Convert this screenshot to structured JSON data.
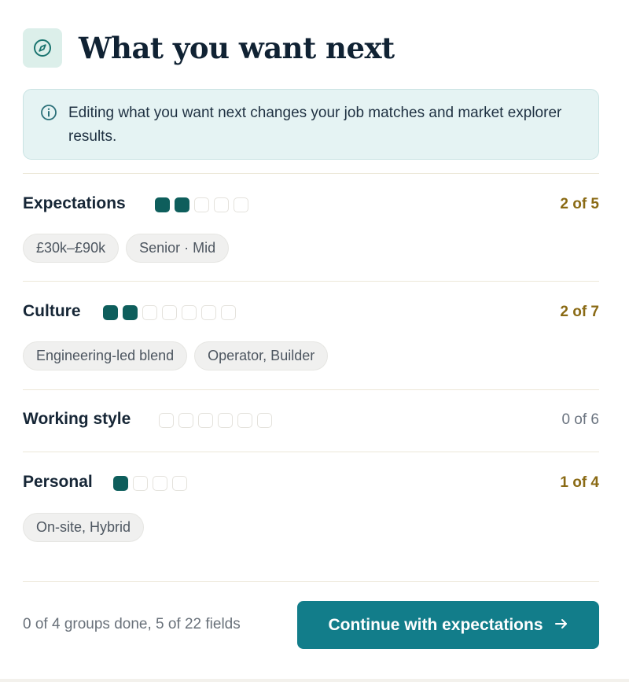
{
  "header": {
    "title": "What you want next",
    "icon": "compass-icon"
  },
  "notice": {
    "icon": "info-icon",
    "text": "Editing what you want next changes your job matches and market explorer results."
  },
  "groups": [
    {
      "title": "Expectations",
      "filled": 2,
      "total": 5,
      "count": "2 of 5",
      "chips": [
        "£30k–£90k",
        "Senior · Mid"
      ]
    },
    {
      "title": "Culture",
      "filled": 2,
      "total": 7,
      "count": "2 of 7",
      "chips": [
        "Engineering-led blend",
        "Operator, Builder"
      ]
    },
    {
      "title": "Working style",
      "filled": 0,
      "total": 6,
      "count": "0 of 6",
      "chips": []
    },
    {
      "title": "Personal",
      "filled": 1,
      "total": 4,
      "count": "1 of 4",
      "chips": [
        "On-site, Hybrid"
      ]
    }
  ],
  "footer": {
    "status": "0 of 4 groups done, 5 of 22 fields",
    "continue_label": "Continue with expectations",
    "continue_icon": "arrow-right-icon"
  },
  "colors": {
    "accent": "#127d8a",
    "progress_filled": "#0e5e5c",
    "count_active": "#8a6a14",
    "notice_bg": "#e5f3f3"
  }
}
